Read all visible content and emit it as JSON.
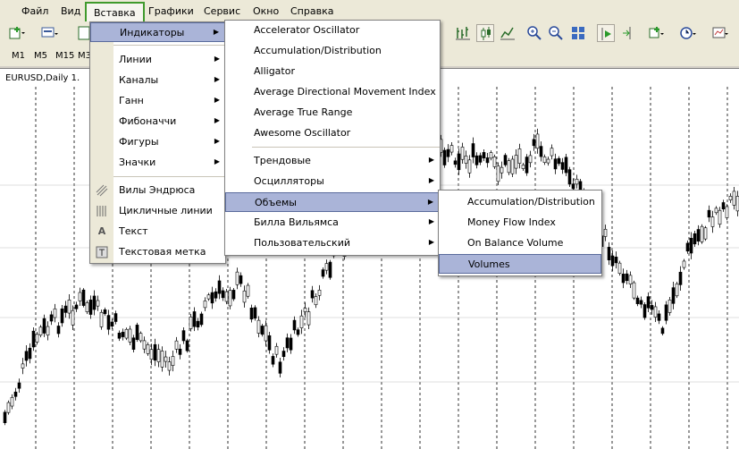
{
  "menubar": {
    "items": [
      "Файл",
      "Вид",
      "Вставка",
      "Графики",
      "Сервис",
      "Окно",
      "Справка"
    ]
  },
  "timeframes": [
    "M1",
    "M5",
    "M15",
    "M3"
  ],
  "chart": {
    "label": "EURUSD,Daily  1."
  },
  "insert_menu": {
    "items": [
      "Индикаторы",
      "Линии",
      "Каналы",
      "Ганн",
      "Фибоначчи",
      "Фигуры",
      "Значки",
      "Вилы Эндрюса",
      "Цикличные линии",
      "Текст",
      "Текстовая метка"
    ],
    "icons": [
      "pitchfork-icon",
      "cycle-lines-icon",
      "text-icon",
      "text-label-icon"
    ]
  },
  "indicators_menu": {
    "items": [
      "Accelerator Oscillator",
      "Accumulation/Distribution",
      "Alligator",
      "Average Directional Movement Index",
      "Average True Range",
      "Awesome Oscillator",
      "Трендовые",
      "Осцилляторы",
      "Объемы",
      "Билла Вильямса",
      "Пользовательский"
    ]
  },
  "volumes_menu": {
    "items": [
      "Accumulation/Distribution",
      "Money Flow Index",
      "On Balance Volume",
      "Volumes"
    ]
  },
  "colors": {
    "highlight": "#aab4d8",
    "menu_frame": "#3f9a2c"
  }
}
